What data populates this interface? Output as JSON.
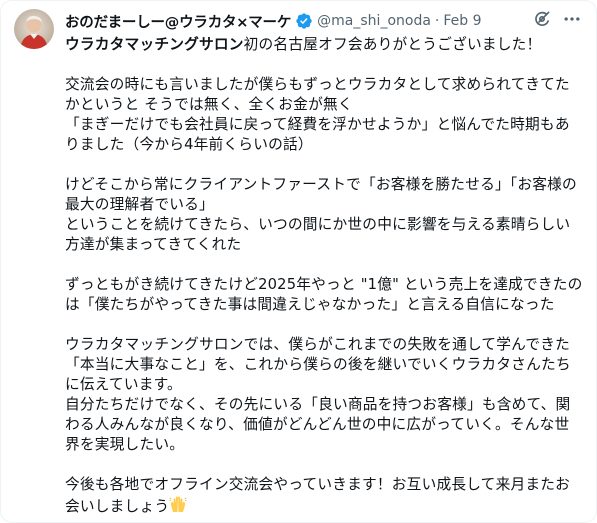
{
  "tweet": {
    "author": {
      "display_name": "おのだまーしー@ウラカタ×マーケ",
      "handle": "@ma_shi_onoda",
      "separator": "·",
      "date": "Feb 9",
      "verified": true
    },
    "icons": {
      "verified": "verified-badge-icon",
      "grok": "grok-icon",
      "more": "more-options-icon"
    },
    "colors": {
      "verified_blue": "#1d9bf0",
      "secondary_text": "#536471"
    },
    "body": {
      "p1": {
        "bold": "ウラカタマッチングサロン",
        "rest": "初の名古屋オフ会ありがとうございました！"
      },
      "p2": [
        "交流会の時にも言いましたが僕らもずっとウラカタとして求められてきてた",
        "かというと そうでは無く、全くお金が無く",
        "「まぎーだけでも会社員に戻って経費を浮かせようか」と悩んでた時期もあ",
        "りました（今から4年前くらいの話）"
      ],
      "p3": [
        "けどそこから常にクライアントファーストで「お客様を勝たせる」「お客様の",
        "最大の理解者でいる」",
        "ということを続けてきたら、いつの間にか世の中に影響を与える素晴らしい",
        "方達が集まってきてくれた"
      ],
      "p4": [
        "ずっともがき続けてきたけど2025年やっと \"1億\" という売上を達成できたの",
        "は「僕たちがやってきた事は間違えじゃなかった」と言える自信になった"
      ],
      "p5": [
        "ウラカタマッチングサロンでは、僕らがこれまでの失敗を通して学んできた",
        "「本当に大事なこと」を、これから僕らの後を継いでいくウラカタさんたち",
        "に伝えています。",
        "自分たちだけでなく、その先にいる「良い商品を持つお客様」も含めて、関",
        "わる人みんなが良くなり、価値がどんどん世の中に広がっていく。そんな世",
        "界を実現したい。"
      ],
      "p6": [
        "今後も各地でオフライン交流会やっていきます！お互い成長して来月またお",
        "会いしましょう"
      ],
      "p6_emoji": "raising-hands-emoji"
    }
  }
}
